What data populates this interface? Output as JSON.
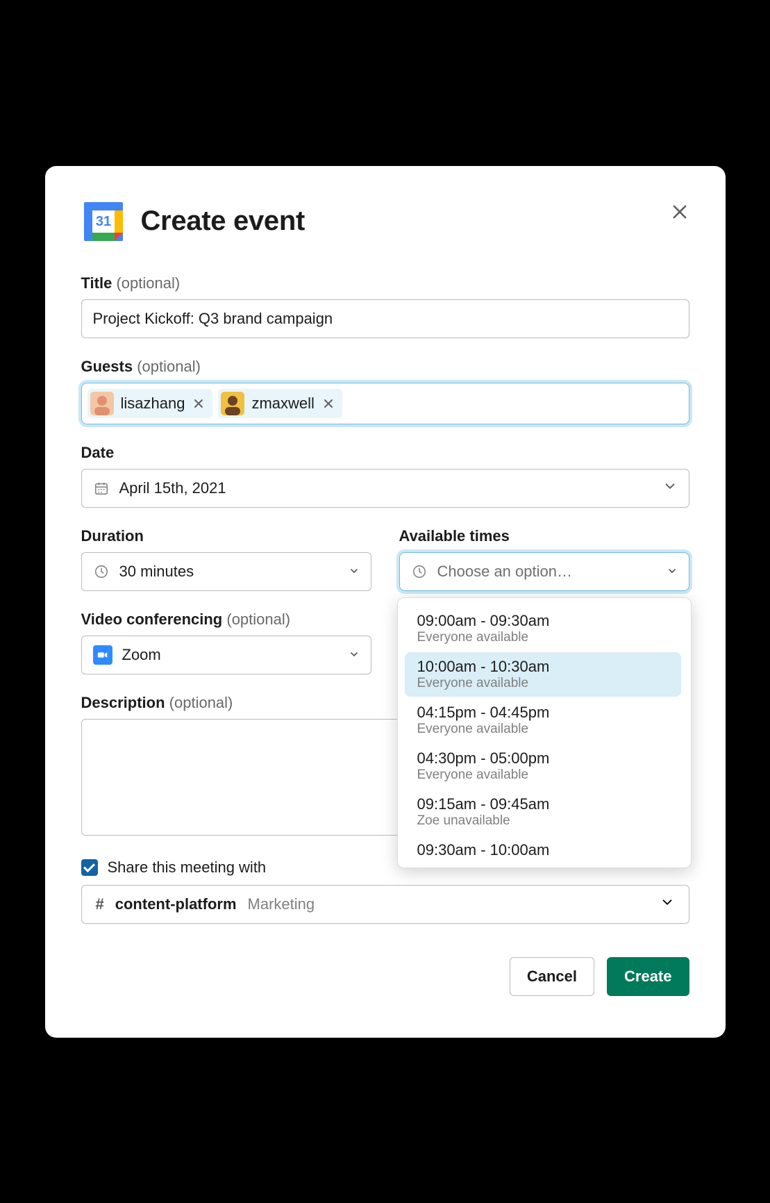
{
  "header": {
    "title": "Create event"
  },
  "title_field": {
    "label": "Title",
    "optional": "(optional)",
    "value": "Project Kickoff: Q3 brand campaign"
  },
  "guests_field": {
    "label": "Guests",
    "optional": "(optional)",
    "chips": [
      {
        "name": "lisazhang"
      },
      {
        "name": "zmaxwell"
      }
    ]
  },
  "date_field": {
    "label": "Date",
    "value": "April 15th, 2021"
  },
  "duration_field": {
    "label": "Duration",
    "value": "30 minutes"
  },
  "available_field": {
    "label": "Available times",
    "placeholder": "Choose an option…",
    "options": [
      {
        "time": "09:00am - 09:30am",
        "sub": "Everyone available",
        "selected": false
      },
      {
        "time": "10:00am - 10:30am",
        "sub": "Everyone available",
        "selected": true
      },
      {
        "time": "04:15pm - 04:45pm",
        "sub": "Everyone available",
        "selected": false
      },
      {
        "time": "04:30pm - 05:00pm",
        "sub": "Everyone available",
        "selected": false
      },
      {
        "time": "09:15am - 09:45am",
        "sub": "Zoe unavailable",
        "selected": false
      },
      {
        "time": "09:30am - 10:00am",
        "sub": "",
        "selected": false
      }
    ]
  },
  "video_field": {
    "label": "Video conferencing",
    "optional": "(optional)",
    "value": "Zoom"
  },
  "description_field": {
    "label": "Description",
    "optional": "(optional)",
    "value": ""
  },
  "share": {
    "checked": true,
    "label": "Share this meeting with",
    "channel": "content-platform",
    "workspace": "Marketing"
  },
  "footer": {
    "cancel": "Cancel",
    "create": "Create"
  }
}
